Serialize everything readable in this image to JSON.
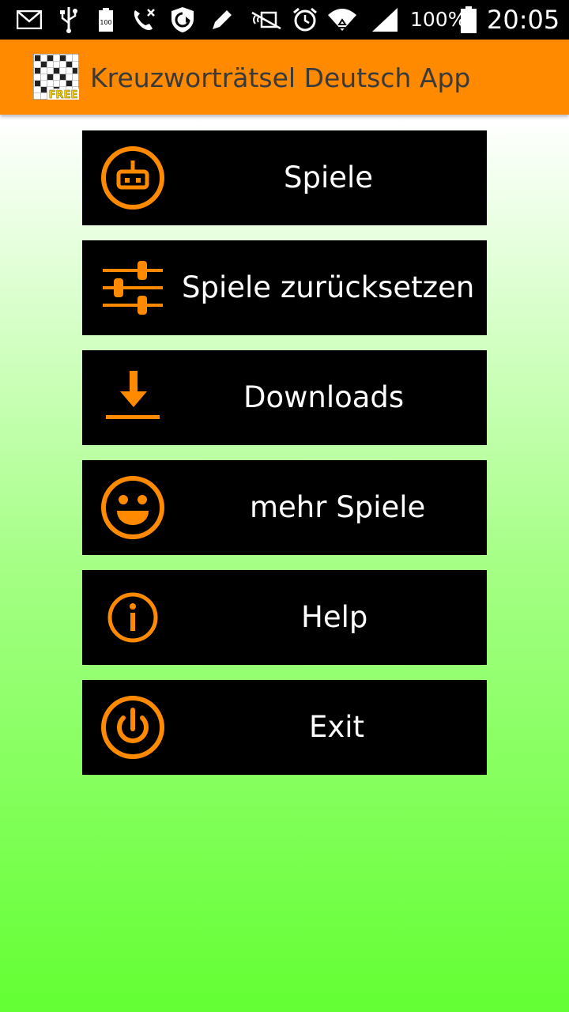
{
  "status_bar": {
    "battery_percent": "100%",
    "time": "20:05",
    "icons": [
      "email-icon",
      "usb-icon",
      "battery-saver-icon",
      "call-icon",
      "shield-icon",
      "edit-icon",
      "nfc-icon",
      "alarm-icon",
      "wifi-icon",
      "signal-icon",
      "battery-icon"
    ]
  },
  "app_bar": {
    "title": "Kreuzworträtsel Deutsch App",
    "logo_badge": "FREE",
    "background_color": "#ff8a00"
  },
  "menu": {
    "items": [
      {
        "label": "Spiele",
        "icon": "games-icon"
      },
      {
        "label": "Spiele zurücksetzen",
        "icon": "sliders-icon"
      },
      {
        "label": "Downloads",
        "icon": "download-icon"
      },
      {
        "label": "mehr Spiele",
        "icon": "smiley-icon"
      },
      {
        "label": "Help",
        "icon": "info-icon"
      },
      {
        "label": "Exit",
        "icon": "power-icon"
      }
    ],
    "button_color": "#000000",
    "icon_color": "#ff8a00",
    "label_color": "#ffffff"
  }
}
